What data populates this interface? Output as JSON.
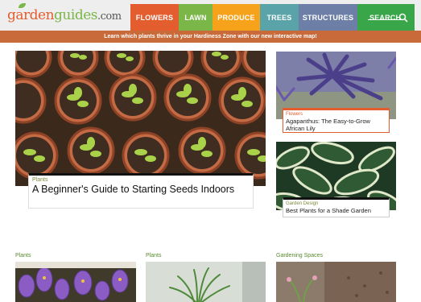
{
  "logo": {
    "part1": "garden",
    "part2": "guides",
    "part3": ".com"
  },
  "nav": {
    "flowers": "FLOWERS",
    "lawn": "LAWN",
    "produce": "PRODUCE",
    "trees": "TREES",
    "structures": "STRUCTURES",
    "search": "SEARCH"
  },
  "banner": "Learn which plants thrive in your Hardiness Zone with our new interactive map!",
  "featured": {
    "category": "Plants",
    "title": "A Beginner's Guide to Starting Seeds Indoors"
  },
  "side_articles": [
    {
      "category": "Flowers",
      "title": "Agapanthus: The Easy-to-Grow African Lily"
    },
    {
      "category": "Garden Design",
      "title": "Best Plants for a Shade Garden"
    }
  ],
  "bottom_sections": [
    "Plants",
    "Plants",
    "Gardening Spaces"
  ],
  "colors": {
    "flowers": "#e35d2e",
    "lawn": "#7ab648",
    "produce": "#f7a21b",
    "trees": "#5aa3a8",
    "structures": "#6d7fa6",
    "search": "#3aa64a",
    "banner": "#c96a3b"
  }
}
